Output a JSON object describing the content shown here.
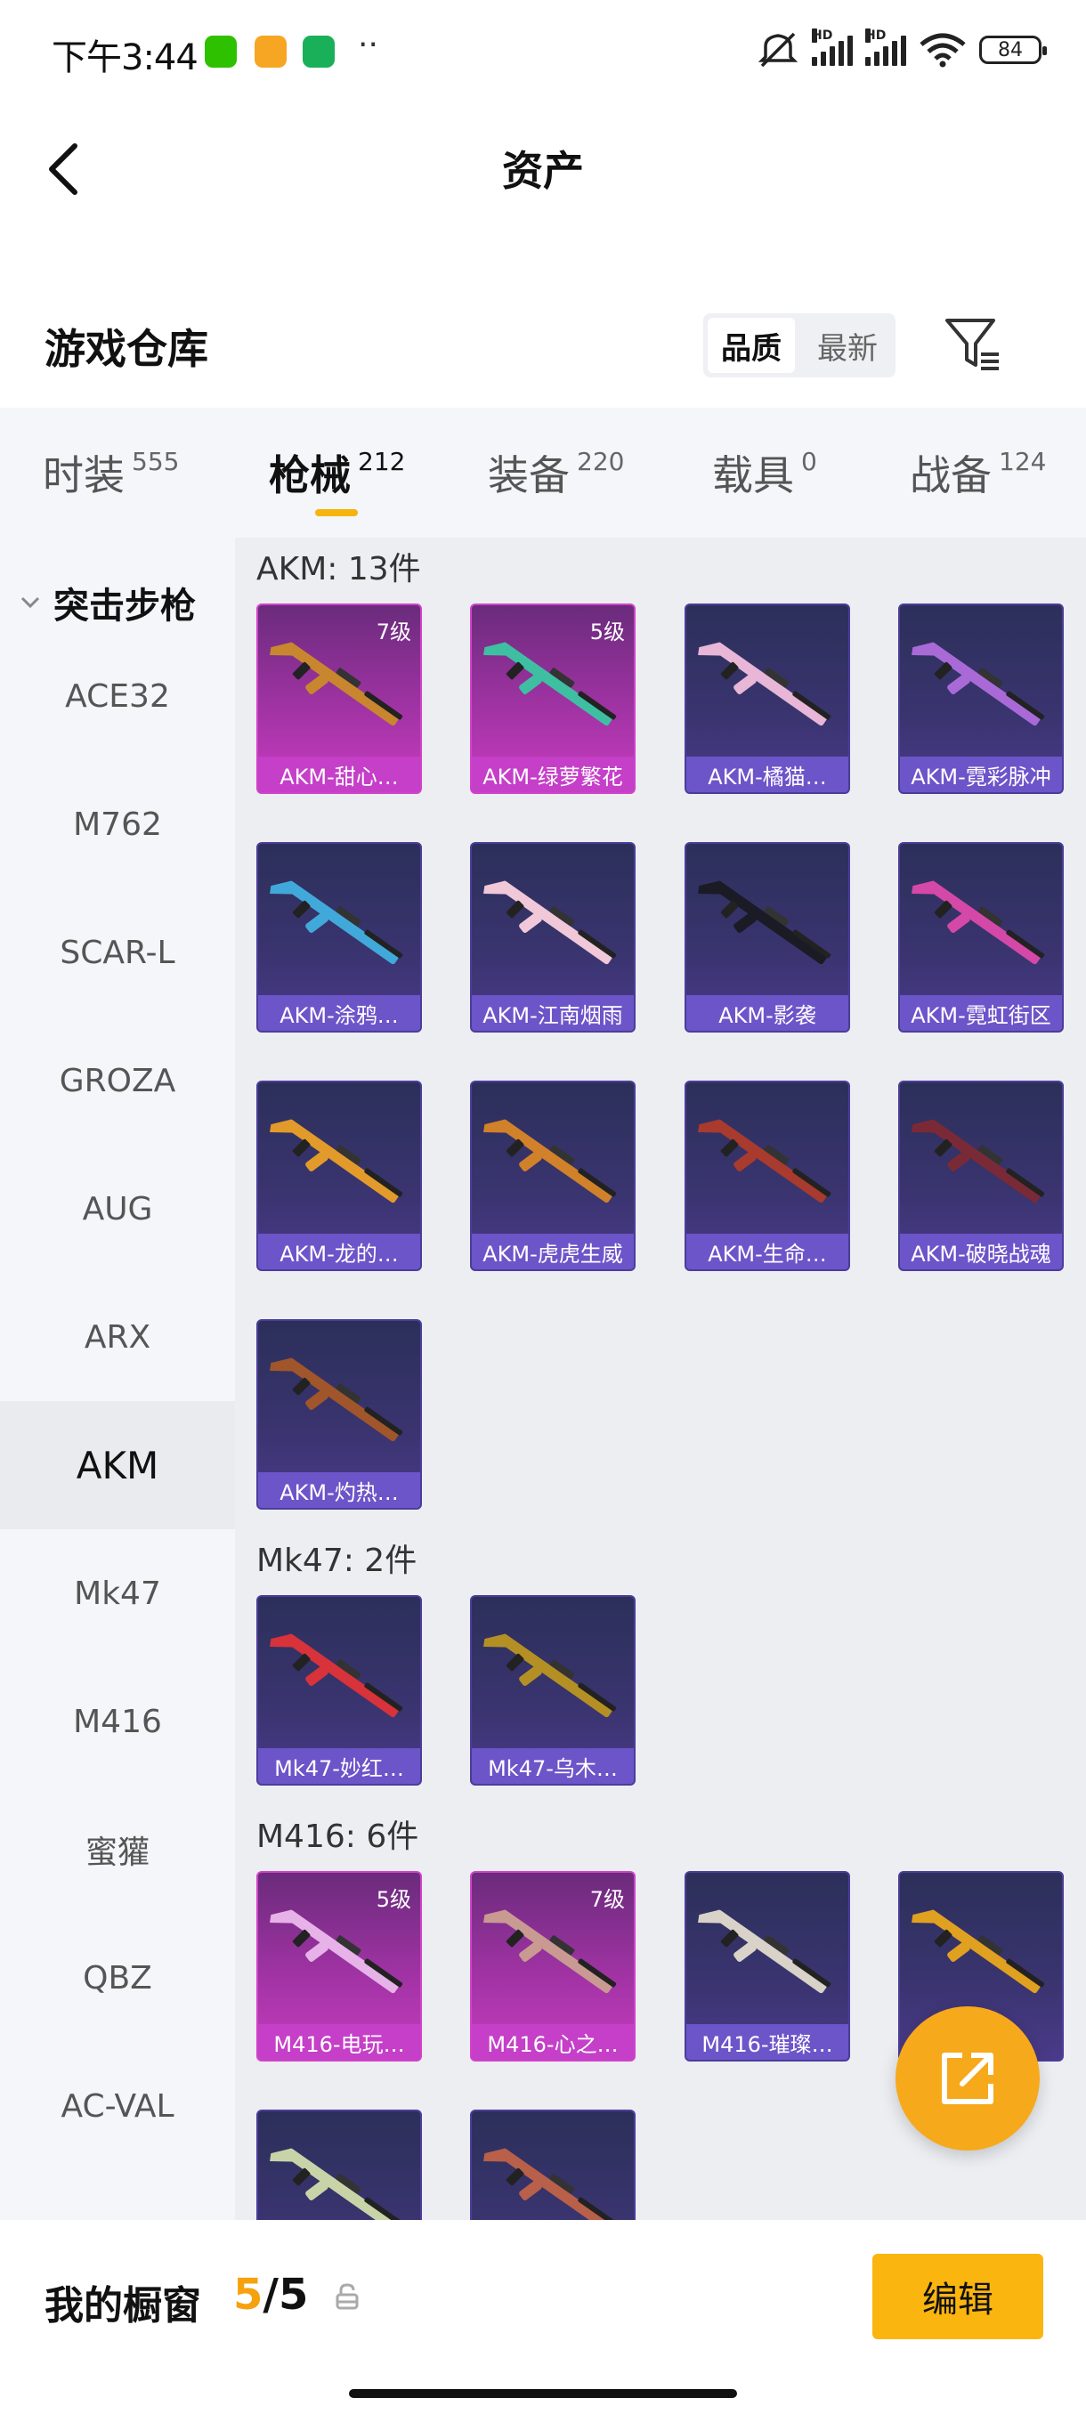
{
  "status_bar": {
    "time": "下午3:44",
    "battery": "84",
    "network_labels": [
      "HD",
      "HD"
    ],
    "app_icons": [
      {
        "name": "wechat-icon",
        "color": "#2dc100"
      },
      {
        "name": "notes-app-icon",
        "color": "#f6a623"
      },
      {
        "name": "phone-app-icon",
        "color": "#1ab05a"
      }
    ]
  },
  "nav": {
    "back_icon": "chevron-left-icon",
    "title": "资产"
  },
  "warehouse": {
    "title": "游戏仓库",
    "sort_options": [
      "品质",
      "最新"
    ],
    "active_sort": "品质",
    "filter_icon": "filter-icon"
  },
  "tabs": [
    {
      "label": "时装",
      "count": "555"
    },
    {
      "label": "枪械",
      "count": "212",
      "active": true
    },
    {
      "label": "装备",
      "count": "220"
    },
    {
      "label": "载具",
      "count": "0"
    },
    {
      "label": "战备",
      "count": "124"
    }
  ],
  "accent_color": "#f5b50e",
  "sidebar": {
    "category": "突击步枪",
    "items": [
      "ACE32",
      "M762",
      "SCAR-L",
      "GROZA",
      "AUG",
      "ARX",
      "AKM",
      "Mk47",
      "M416",
      "蜜獾",
      "QBZ",
      "AC-VAL"
    ],
    "active_item": "AKM"
  },
  "groups": [
    {
      "title": "AKM: 13件",
      "items": [
        {
          "name": "AKM-甜心…",
          "level": "7级",
          "rarity": "epic",
          "color": "#c8862e"
        },
        {
          "name": "AKM-绿萝繁花",
          "level": "5级",
          "rarity": "epic",
          "color": "#3fbfa2"
        },
        {
          "name": "AKM-橘猫…",
          "level": "",
          "rarity": "normal",
          "color": "#e8b6d6"
        },
        {
          "name": "AKM-霓彩脉冲",
          "level": "",
          "rarity": "normal",
          "color": "#a96ad8"
        },
        {
          "name": "AKM-涂鸦…",
          "level": "",
          "rarity": "normal",
          "color": "#41a9d9"
        },
        {
          "name": "AKM-江南烟雨",
          "level": "",
          "rarity": "normal",
          "color": "#f0c8d8"
        },
        {
          "name": "AKM-影袭",
          "level": "",
          "rarity": "normal",
          "color": "#1b1b26"
        },
        {
          "name": "AKM-霓虹街区",
          "level": "",
          "rarity": "normal",
          "color": "#d448a8"
        },
        {
          "name": "AKM-龙的…",
          "level": "",
          "rarity": "normal",
          "color": "#e29a2a"
        },
        {
          "name": "AKM-虎虎生威",
          "level": "",
          "rarity": "normal",
          "color": "#d0812a"
        },
        {
          "name": "AKM-生命…",
          "level": "",
          "rarity": "normal",
          "color": "#a83a2e"
        },
        {
          "name": "AKM-破晓战魂",
          "level": "",
          "rarity": "normal",
          "color": "#7a2a36"
        },
        {
          "name": "AKM-灼热…",
          "level": "",
          "rarity": "normal",
          "color": "#a0562a"
        }
      ]
    },
    {
      "title": "Mk47: 2件",
      "items": [
        {
          "name": "Mk47-妙红…",
          "level": "",
          "rarity": "normal",
          "color": "#d8323a"
        },
        {
          "name": "Mk47-乌木…",
          "level": "",
          "rarity": "normal",
          "color": "#b49024"
        }
      ]
    },
    {
      "title": "M416: 6件",
      "items": [
        {
          "name": "M416-电玩…",
          "level": "5级",
          "rarity": "epic",
          "color": "#e6b2e8"
        },
        {
          "name": "M416-心之…",
          "level": "7级",
          "rarity": "epic",
          "color": "#c99a92"
        },
        {
          "name": "M416-璀璨…",
          "level": "",
          "rarity": "normal",
          "color": "#d8d2c8"
        },
        {
          "name": "",
          "level": "",
          "rarity": "normal",
          "color": "#e0a020"
        },
        {
          "name": "",
          "level": "",
          "rarity": "normal",
          "color": "#c8d4a8"
        },
        {
          "name": "",
          "level": "",
          "rarity": "normal",
          "color": "#b8604a"
        }
      ]
    }
  ],
  "fab_icon": "share-external-icon",
  "bottom_bar": {
    "label": "我的橱窗",
    "current": "5",
    "separator": "/",
    "total": "5",
    "lock_icon": "lock-icon",
    "edit_label": "编辑"
  }
}
